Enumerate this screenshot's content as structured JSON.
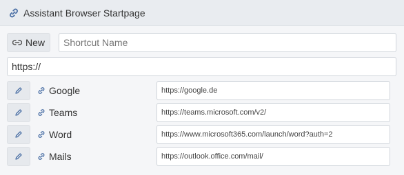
{
  "app": {
    "title": "Assistant Browser Startpage"
  },
  "new_form": {
    "new_button_label": "New",
    "name_placeholder": "Shortcut Name",
    "url_value": "https://"
  },
  "shortcuts": [
    {
      "name": "Google",
      "url": "https://google.de"
    },
    {
      "name": "Teams",
      "url": "https://teams.microsoft.com/v2/"
    },
    {
      "name": "Word",
      "url": "https://www.microsoft365.com/launch/word?auth=2"
    },
    {
      "name": "Mails",
      "url": "https://outlook.office.com/mail/"
    }
  ],
  "colors": {
    "accent": "#4a6fa5"
  },
  "icons": {
    "title": "link-icon",
    "new": "unlink-icon",
    "edit": "pencil-icon",
    "shortcut": "link-icon"
  }
}
